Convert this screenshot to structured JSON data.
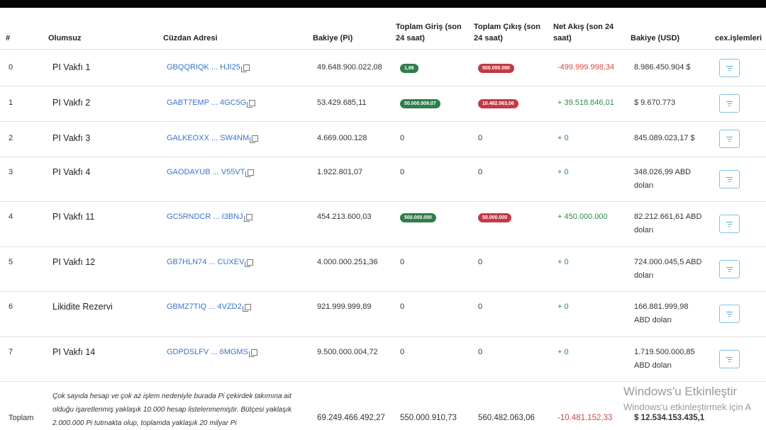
{
  "columns": {
    "idx": "#",
    "name": "Olumsuz",
    "address": "Cüzdan Adresi",
    "balance": "Bakiye (Pi)",
    "inflow_line1": "Toplam Giriş (son",
    "inflow_line2": "24 saat)",
    "outflow_line1": "Toplam Çıkış (son",
    "outflow_line2": "24 saat)",
    "net_line1": "Net Akış (son 24",
    "net_line2": "saat)",
    "usd": "Bakiye (USD)",
    "cex": "cex.işlemleri"
  },
  "rows": [
    {
      "idx": "0",
      "name": "PI Vakfı 1",
      "address": "GBQQRIQK ... HJI25",
      "balance": "49.648.900.022,08",
      "inflow": "1,66",
      "inflow_badge": "green",
      "outflow": "500.000.000",
      "outflow_badge": "red",
      "net": "-499.999.998,34",
      "net_style": "neg",
      "usd1": "8.986.450.904 $",
      "usd2": ""
    },
    {
      "idx": "1",
      "name": "PI Vakfı 2",
      "address": "GABT7EMP ... 4GC5G",
      "balance": "53.429.685,11",
      "inflow": "50.000.909,07",
      "inflow_badge": "green",
      "outflow": "10.482.063,06",
      "outflow_badge": "red",
      "net": "+ 39.518.846,01",
      "net_style": "pos",
      "usd1": "$ 9.670.773",
      "usd2": ""
    },
    {
      "idx": "2",
      "name": "PI Vakfı 3",
      "address": "GALKEOXX ... SW4NM",
      "balance": "4.669.000.128",
      "inflow": "0",
      "inflow_badge": "",
      "outflow": "0",
      "outflow_badge": "",
      "net": "+ 0",
      "net_style": "pos",
      "usd1": "845.089.023,17 $",
      "usd2": ""
    },
    {
      "idx": "3",
      "name": "PI Vakfı 4",
      "address": "GAODAYUB ... V55VT",
      "balance": "1.922.801,07",
      "inflow": "0",
      "inflow_badge": "",
      "outflow": "0",
      "outflow_badge": "",
      "net": "+ 0",
      "net_style": "pos",
      "usd1": "348.026,99 ABD",
      "usd2": "doları"
    },
    {
      "idx": "4",
      "name": "PI Vakfı 11",
      "address": "GC5RNDCR ... I3BNJ",
      "balance": "454.213.600,03",
      "inflow": "500.000.000",
      "inflow_badge": "green",
      "outflow": "50.000.000",
      "outflow_badge": "red",
      "net": "+ 450.000.000",
      "net_style": "pos",
      "usd1": "82.212.661,61 ABD",
      "usd2": "doları"
    },
    {
      "idx": "5",
      "name": "PI Vakfı 12",
      "address": "GB7HLN74 ... CUXEV",
      "balance": "4.000.000.251,36",
      "inflow": "0",
      "inflow_badge": "",
      "outflow": "0",
      "outflow_badge": "",
      "net": "+ 0",
      "net_style": "pos",
      "usd1": "724.000.045,5 ABD",
      "usd2": "doları"
    },
    {
      "idx": "6",
      "name": "Likidite Rezervi",
      "address": "GBMZ7TIQ ... 4VZD2",
      "balance": "921.999.999,89",
      "inflow": "0",
      "inflow_badge": "",
      "outflow": "0",
      "outflow_badge": "",
      "net": "+ 0",
      "net_style": "pos",
      "usd1": "166.881.999,98",
      "usd2": "ABD doları"
    },
    {
      "idx": "7",
      "name": "PI Vakfı 14",
      "address": "GDPDSLFV ... 6MGMS",
      "balance": "9.500.000.004,72",
      "inflow": "0",
      "inflow_badge": "",
      "outflow": "0",
      "outflow_badge": "",
      "net": "+ 0",
      "net_style": "pos",
      "usd1": "1.719.500.000,85",
      "usd2": "ABD doları"
    }
  ],
  "total": {
    "label": "Toplam",
    "note": "Çok sayıda hesap ve çok az işlem nedeniyle burada Pi çekirdek takımına ait olduğu işaretlenmiş yaklaşık 10.000 hesap listelenmemiştir. Bütçesi yaklaşık 2.000.000 Pi tutmakta olup, toplamda yaklaşık 20 milyar Pi",
    "balance": "69.249.466.492,27",
    "inflow": "550.000.910,73",
    "outflow": "560.482.063,06",
    "net": "-10.481.152,33",
    "usd": "$ 12.534.153.435,1"
  },
  "watermark": {
    "line1": "Windows'u Etkinleştir",
    "line2": "Windows'u etkinleştirmek için A"
  },
  "icons": {
    "copy": "copy-icon",
    "filter": "filter-icon"
  }
}
